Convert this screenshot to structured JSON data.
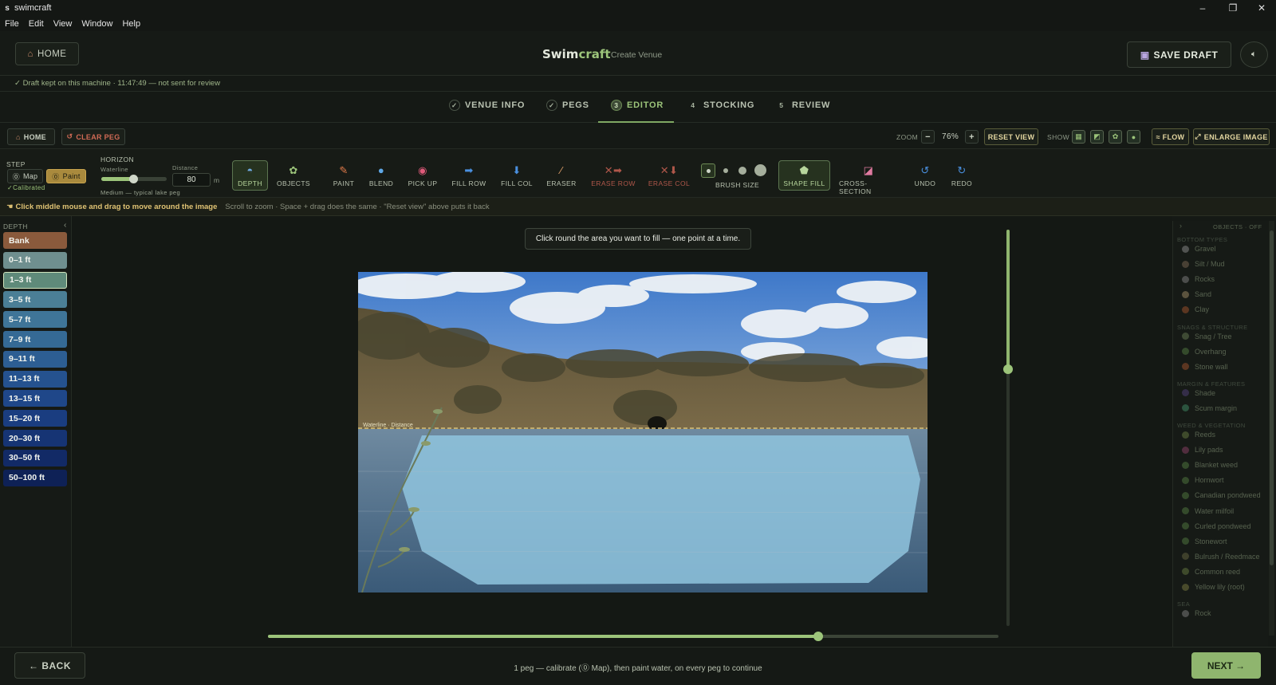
{
  "window": {
    "icon_letter": "s",
    "title": "swimcraft",
    "minimize": "–",
    "maximize": "❐",
    "close": "✕"
  },
  "menu": [
    "File",
    "Edit",
    "View",
    "Window",
    "Help"
  ],
  "header": {
    "home_label": "HOME",
    "brand_swim": "Swim",
    "brand_craft": "craft",
    "subtitle": "Create Venue",
    "save_label": "SAVE DRAFT"
  },
  "draft_status": "✓ Draft kept on this machine · 11:47:49 — not sent for review",
  "steps": [
    {
      "num": "✓",
      "label": "VENUE INFO"
    },
    {
      "num": "✓",
      "label": "PEGS"
    },
    {
      "num": "3",
      "label": "EDITOR"
    },
    {
      "num": "4",
      "label": "STOCKING"
    },
    {
      "num": "5",
      "label": "REVIEW"
    }
  ],
  "toolbar": {
    "home_label": "HOME",
    "clear_peg_label": "CLEAR PEG",
    "zoom_label": "ZOOM",
    "zoom_minus": "−",
    "zoom_value": "76%",
    "zoom_plus": "+",
    "reset_view_label": "RESET VIEW",
    "show_label": "SHOW",
    "flow_label": "≈ FLOW",
    "enlarge_label": "ENLARGE IMAGE"
  },
  "step_panel": {
    "title": "STEP",
    "map_label": "Map",
    "paint_label": "Paint",
    "calibrated": "✓Calibrated",
    "horizon_title": "HORIZON",
    "waterline_label": "Waterline",
    "waterline_level": 0.7,
    "distance_label": "Distance",
    "distance_value": "80",
    "distance_unit": "m",
    "peg_type": "Medium — typical lake peg"
  },
  "tools": [
    {
      "label": "DEPTH",
      "icon": "depth-icon"
    },
    {
      "label": "OBJECTS",
      "icon": "plant-icon"
    },
    {
      "label": "PAINT",
      "icon": "brush-icon"
    },
    {
      "label": "BLEND",
      "icon": "drop-icon"
    },
    {
      "label": "PICK UP",
      "icon": "picker-icon"
    },
    {
      "label": "FILL ROW",
      "icon": "fill-row-icon"
    },
    {
      "label": "FILL COL",
      "icon": "fill-col-icon"
    },
    {
      "label": "ERASER",
      "icon": "eraser-icon"
    },
    {
      "label": "ERASE ROW",
      "icon": "erase-row-icon"
    },
    {
      "label": "ERASE COL",
      "icon": "erase-col-icon"
    },
    {
      "label": "BRUSH SIZE",
      "icon": "brush-size-icon"
    },
    {
      "label": "SHAPE FILL",
      "icon": "pentagon-icon"
    },
    {
      "label": "CROSS-SECTION",
      "icon": "cross-section-icon"
    },
    {
      "label": "UNDO",
      "icon": "undo-icon"
    },
    {
      "label": "REDO",
      "icon": "redo-icon"
    }
  ],
  "hint": {
    "main": "Click middle mouse and drag to move around the image",
    "sub": "Scroll to zoom · Space + drag does the same · \"Reset view\" above puts it back"
  },
  "depth": {
    "title": "DEPTH",
    "collapse": "‹",
    "levels": [
      {
        "label": "Bank",
        "color": "#8a5a3c"
      },
      {
        "label": "0–1 ft",
        "color": "#6f8f8f"
      },
      {
        "label": "1–3 ft",
        "color": "#5f8a7a"
      },
      {
        "label": "3–5 ft",
        "color": "#4b7f96"
      },
      {
        "label": "5–7 ft",
        "color": "#3f7598"
      },
      {
        "label": "7–9 ft",
        "color": "#356a95"
      },
      {
        "label": "9–11 ft",
        "color": "#2d5e93"
      },
      {
        "label": "11–13 ft",
        "color": "#25528f"
      },
      {
        "label": "13–15 ft",
        "color": "#1f4789"
      },
      {
        "label": "15–20 ft",
        "color": "#1a3d80"
      },
      {
        "label": "20–30 ft",
        "color": "#163474"
      },
      {
        "label": "30–50 ft",
        "color": "#122a66"
      },
      {
        "label": "50–100 ft",
        "color": "#0e2156"
      }
    ]
  },
  "canvas": {
    "tooltip": "Click round the area you want to fill — one point at a time.",
    "waterline_tag": "Waterline · Distance"
  },
  "objects": {
    "title": "OBJECTS · OFF",
    "expand": "›",
    "groups": [
      {
        "title": "BOTTOM TYPES",
        "items": [
          {
            "label": "Gravel",
            "color": "#7a7a7a"
          },
          {
            "label": "Silt / Mud",
            "color": "#6b5a4a"
          },
          {
            "label": "Rocks",
            "color": "#707070"
          },
          {
            "label": "Sand",
            "color": "#8a7a5a"
          },
          {
            "label": "Clay",
            "color": "#8a4a2a"
          }
        ]
      },
      {
        "title": "SNAGS & STRUCTURE",
        "items": [
          {
            "label": "Snag / Tree",
            "color": "#5a6a4a"
          },
          {
            "label": "Overhang",
            "color": "#4a6a3a"
          },
          {
            "label": "Stone wall",
            "color": "#8a4a2a"
          }
        ]
      },
      {
        "title": "MARGIN & FEATURES",
        "items": [
          {
            "label": "Shade",
            "color": "#4a3a6a"
          },
          {
            "label": "Scum margin",
            "color": "#3a7a5a"
          }
        ]
      },
      {
        "title": "WEED & VEGETATION",
        "items": [
          {
            "label": "Reeds",
            "color": "#5a6a3a"
          },
          {
            "label": "Lily pads",
            "color": "#7a3a5a"
          },
          {
            "label": "Blanket weed",
            "color": "#4a6a3a"
          },
          {
            "label": "Hornwort",
            "color": "#4a6a3a"
          },
          {
            "label": "Canadian pondweed",
            "color": "#4a6a3a"
          },
          {
            "label": "Water milfoil",
            "color": "#4a6a3a"
          },
          {
            "label": "Curled pondweed",
            "color": "#4a6a3a"
          },
          {
            "label": "Stonewort",
            "color": "#4a6a3a"
          },
          {
            "label": "Bulrush / Reedmace",
            "color": "#5a5a3a"
          },
          {
            "label": "Common reed",
            "color": "#5a6a3a"
          },
          {
            "label": "Yellow lily (root)",
            "color": "#6a6a3a"
          }
        ]
      },
      {
        "title": "SEA",
        "items": [
          {
            "label": "Rock",
            "color": "#707070"
          }
        ]
      }
    ]
  },
  "footer": {
    "back_label": "← BACK",
    "message": "1 peg — calibrate (⓪ Map), then paint water, on every peg to continue",
    "next_label": "NEXT →"
  },
  "colors": {
    "accent": "#9cc47a",
    "warning": "#e0c374",
    "danger": "#b0574a",
    "bg": "#151915"
  }
}
